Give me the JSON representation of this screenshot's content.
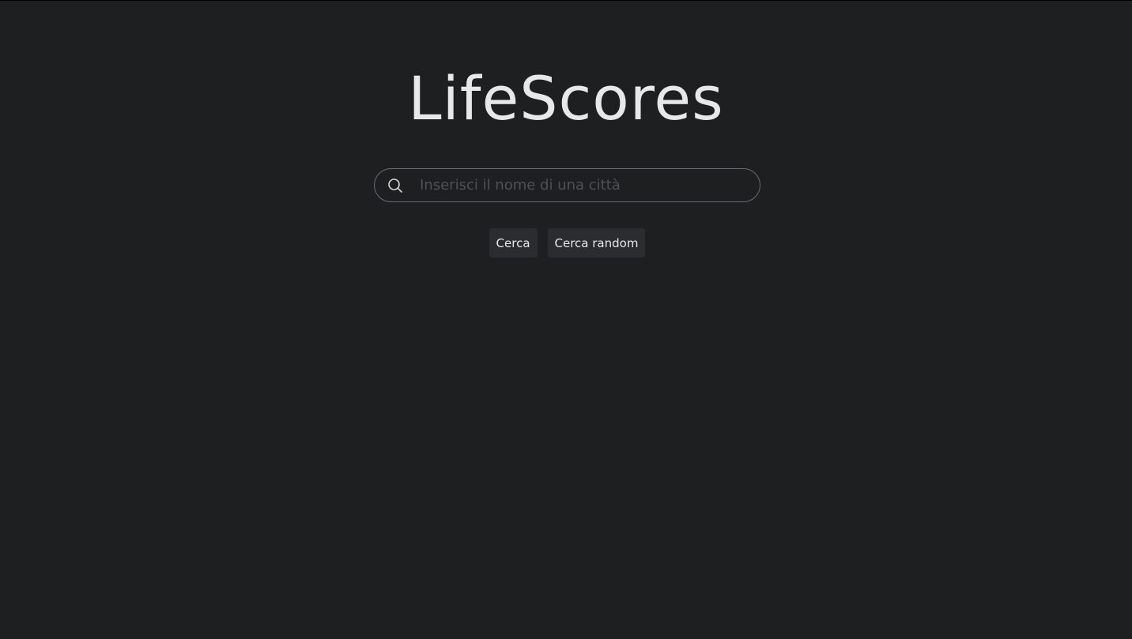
{
  "header": {
    "title": "LifeScores"
  },
  "search": {
    "placeholder": "Inserisci il nome di una città",
    "value": "",
    "icon": "search-icon"
  },
  "actions": {
    "search_label": "Cerca",
    "random_label": "Cerca random"
  },
  "colors": {
    "background": "#1e1f21",
    "text": "#e8e8ea",
    "button_bg": "#2b2c2f",
    "input_border": "#6a6b6e",
    "placeholder": "#4f5054"
  }
}
